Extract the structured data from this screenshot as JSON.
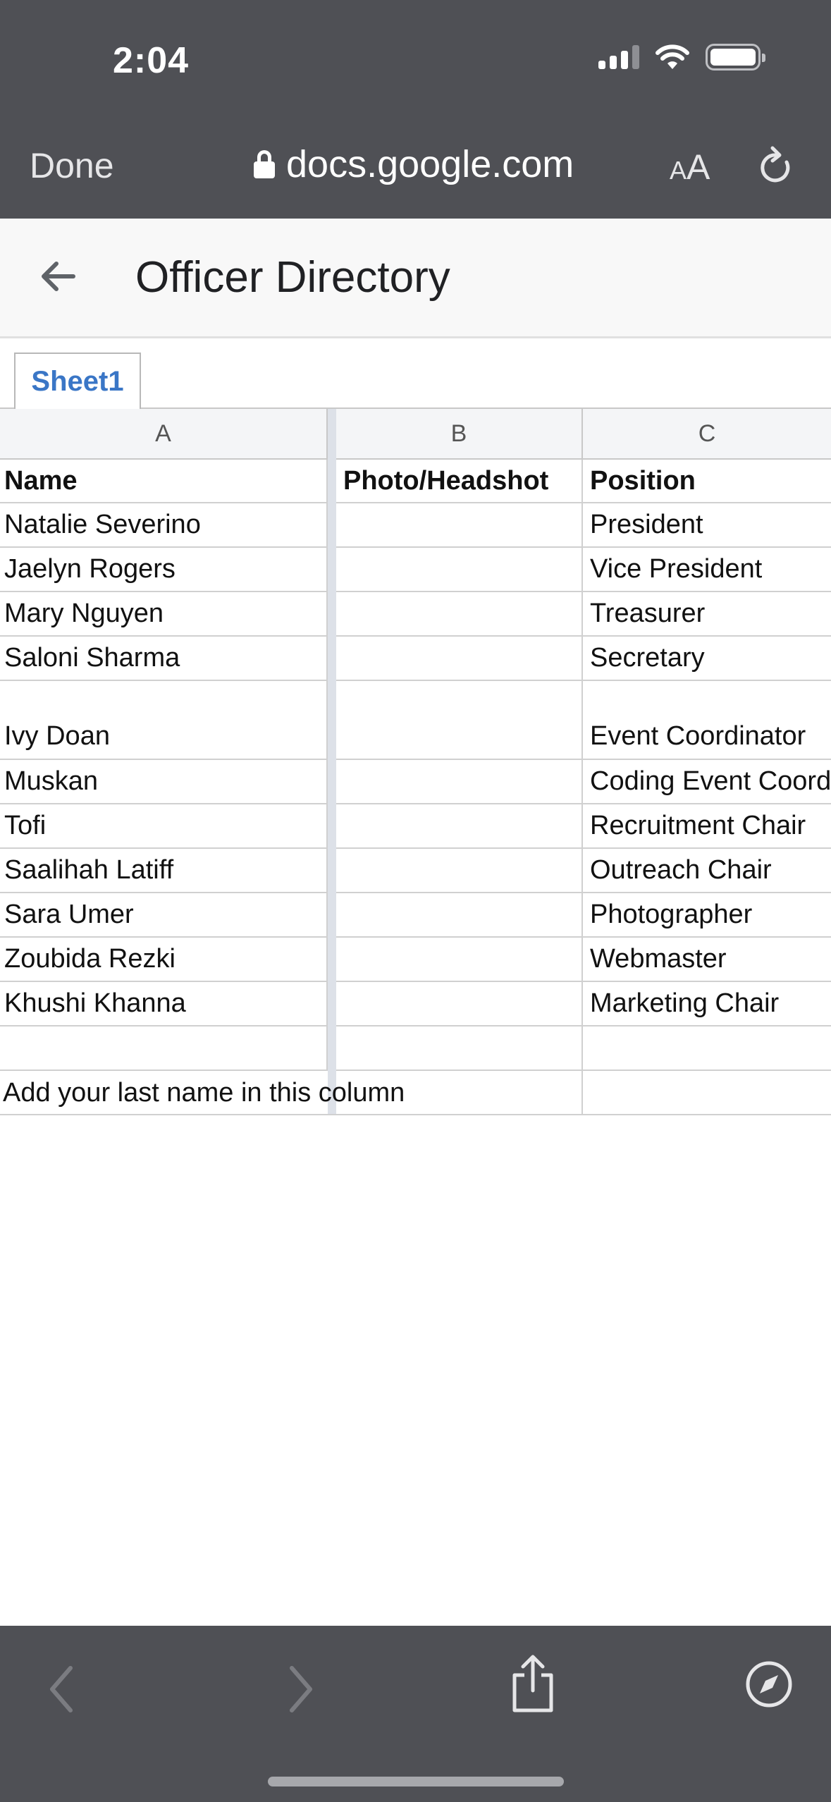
{
  "status_bar": {
    "time": "2:04"
  },
  "browser": {
    "done_label": "Done",
    "url": "docs.google.com",
    "text_size_small": "A",
    "text_size_large": "A"
  },
  "document": {
    "title": "Officer Directory"
  },
  "sheet_tabs": [
    {
      "label": "Sheet1"
    }
  ],
  "columns": [
    "A",
    "B",
    "C"
  ],
  "rows": [
    {
      "a": "Name",
      "b": "Photo/Headshot",
      "c": "Position"
    },
    {
      "a": "Natalie Severino",
      "b": "",
      "c": "President"
    },
    {
      "a": "Jaelyn Rogers",
      "b": "",
      "c": "Vice President"
    },
    {
      "a": "Mary Nguyen",
      "b": "",
      "c": "Treasurer"
    },
    {
      "a": "Saloni Sharma",
      "b": "",
      "c": "Secretary"
    },
    {
      "a": "Ivy Doan",
      "b": "",
      "c": "Event Coordinator"
    },
    {
      "a": "Muskan",
      "b": "",
      "c": "Coding Event Coordinator"
    },
    {
      "a": "Tofi",
      "b": "",
      "c": "Recruitment Chair"
    },
    {
      "a": "Saalihah Latiff",
      "b": "",
      "c": "Outreach Chair"
    },
    {
      "a": "Sara Umer",
      "b": "",
      "c": "Photographer"
    },
    {
      "a": "Zoubida Rezki",
      "b": "",
      "c": "Webmaster"
    },
    {
      "a": "Khushi Khanna",
      "b": "",
      "c": "Marketing Chair"
    },
    {
      "a": "",
      "b": "",
      "c": ""
    }
  ],
  "note_row": "Add your last name in this column"
}
